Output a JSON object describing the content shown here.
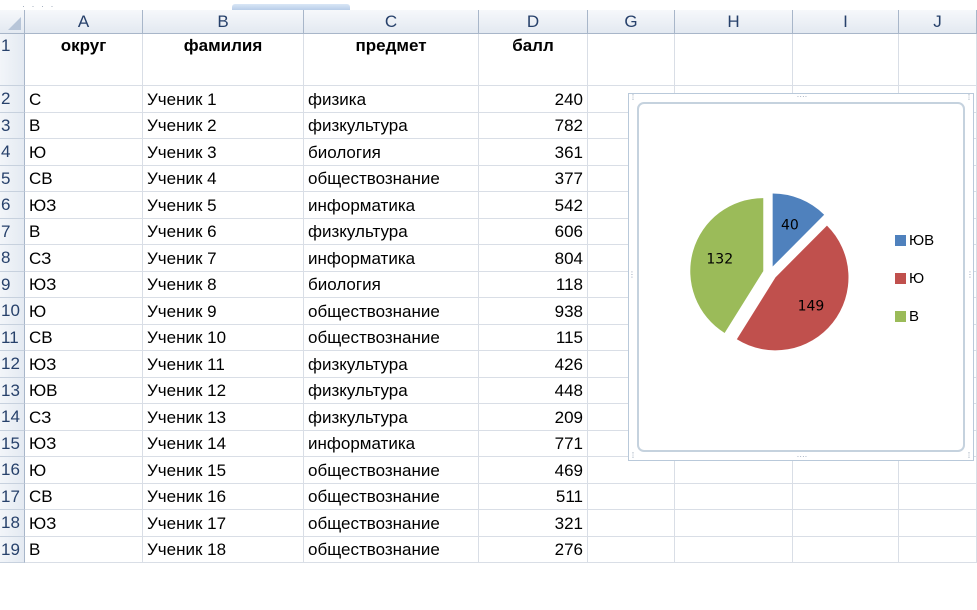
{
  "columns": [
    "A",
    "B",
    "C",
    "D",
    "G",
    "H",
    "I",
    "J"
  ],
  "header_row": {
    "row_num": "1",
    "A": "округ",
    "B": "фамилия",
    "C": "предмет",
    "D": "балл"
  },
  "rows": [
    {
      "row_num": "2",
      "A": "С",
      "B": "Ученик 1",
      "C": "физика",
      "D": "240"
    },
    {
      "row_num": "3",
      "A": "В",
      "B": "Ученик 2",
      "C": "физкультура",
      "D": "782"
    },
    {
      "row_num": "4",
      "A": "Ю",
      "B": "Ученик 3",
      "C": "биология",
      "D": "361"
    },
    {
      "row_num": "5",
      "A": "СВ",
      "B": "Ученик 4",
      "C": "обществознание",
      "D": "377"
    },
    {
      "row_num": "6",
      "A": "ЮЗ",
      "B": "Ученик 5",
      "C": "информатика",
      "D": "542"
    },
    {
      "row_num": "7",
      "A": "В",
      "B": "Ученик 6",
      "C": "физкультура",
      "D": "606"
    },
    {
      "row_num": "8",
      "A": "СЗ",
      "B": "Ученик 7",
      "C": "информатика",
      "D": "804"
    },
    {
      "row_num": "9",
      "A": "ЮЗ",
      "B": "Ученик 8",
      "C": "биология",
      "D": "118"
    },
    {
      "row_num": "10",
      "A": "Ю",
      "B": "Ученик 9",
      "C": "обществознание",
      "D": "938"
    },
    {
      "row_num": "11",
      "A": "СВ",
      "B": "Ученик 10",
      "C": "обществознание",
      "D": "115"
    },
    {
      "row_num": "12",
      "A": "ЮЗ",
      "B": "Ученик 11",
      "C": "физкультура",
      "D": "426"
    },
    {
      "row_num": "13",
      "A": "ЮВ",
      "B": "Ученик 12",
      "C": "физкультура",
      "D": "448"
    },
    {
      "row_num": "14",
      "A": "СЗ",
      "B": "Ученик 13",
      "C": "физкультура",
      "D": "209"
    },
    {
      "row_num": "15",
      "A": "ЮЗ",
      "B": "Ученик 14",
      "C": "информатика",
      "D": "771"
    },
    {
      "row_num": "16",
      "A": "Ю",
      "B": "Ученик 15",
      "C": "обществознание",
      "D": "469"
    },
    {
      "row_num": "17",
      "A": "СВ",
      "B": "Ученик 16",
      "C": "обществознание",
      "D": "511"
    },
    {
      "row_num": "18",
      "A": "ЮЗ",
      "B": "Ученик 17",
      "C": "обществознание",
      "D": "321"
    },
    {
      "row_num": "19",
      "A": "В",
      "B": "Ученик 18",
      "C": "обществознание",
      "D": "276"
    }
  ],
  "chart_data": {
    "type": "pie",
    "exploded": true,
    "categories": [
      "ЮВ",
      "Ю",
      "В"
    ],
    "values": [
      40,
      149,
      132
    ],
    "colors": [
      "#4f81bd",
      "#c0504d",
      "#9bbb59"
    ],
    "data_labels": [
      "40",
      "149",
      "132"
    ],
    "legend_position": "right",
    "title": ""
  },
  "colors": {
    "header_bg": "#e3e9f1",
    "header_text": "#27416b",
    "gridline": "#d9dee6"
  }
}
